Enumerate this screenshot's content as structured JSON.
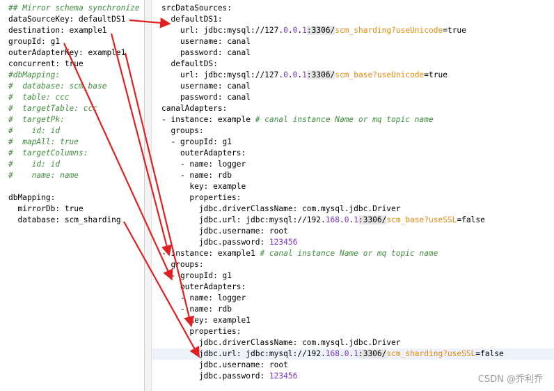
{
  "left_editor": {
    "lines": [
      {
        "parts": [
          {
            "t": "## Mirror schema synchronize",
            "c": "cmt"
          }
        ]
      },
      {
        "parts": [
          {
            "t": "dataSourceKey: defaultDS1",
            "c": ""
          }
        ]
      },
      {
        "parts": [
          {
            "t": "destination: example1",
            "c": ""
          }
        ]
      },
      {
        "parts": [
          {
            "t": "groupId: g1",
            "c": ""
          }
        ]
      },
      {
        "parts": [
          {
            "t": "outerAdapterKey: example1",
            "c": ""
          }
        ]
      },
      {
        "parts": [
          {
            "t": "concurrent: true",
            "c": ""
          }
        ]
      },
      {
        "parts": [
          {
            "t": "#dbMapping:",
            "c": "cmt"
          }
        ]
      },
      {
        "parts": [
          {
            "t": "#  database: scm_base",
            "c": "cmt"
          }
        ]
      },
      {
        "parts": [
          {
            "t": "#  table: ccc",
            "c": "cmt"
          }
        ]
      },
      {
        "parts": [
          {
            "t": "#  targetTable: ccc",
            "c": "cmt"
          }
        ]
      },
      {
        "parts": [
          {
            "t": "#  targetPk:",
            "c": "cmt"
          }
        ]
      },
      {
        "parts": [
          {
            "t": "#    id: id",
            "c": "cmt"
          }
        ]
      },
      {
        "parts": [
          {
            "t": "#  mapAll: true",
            "c": "cmt"
          }
        ]
      },
      {
        "parts": [
          {
            "t": "#  targetColumns:",
            "c": "cmt"
          }
        ]
      },
      {
        "parts": [
          {
            "t": "#    id: id",
            "c": "cmt"
          }
        ]
      },
      {
        "parts": [
          {
            "t": "#    name: name",
            "c": "cmt"
          }
        ]
      },
      {
        "parts": [
          {
            "t": "",
            "c": ""
          }
        ]
      },
      {
        "parts": [
          {
            "t": "dbMapping:",
            "c": ""
          }
        ]
      },
      {
        "parts": [
          {
            "t": "  mirrorDb: true",
            "c": ""
          }
        ]
      },
      {
        "parts": [
          {
            "t": "  database: scm_sharding",
            "c": ""
          }
        ]
      }
    ]
  },
  "right_editor": {
    "lines": [
      {
        "parts": [
          {
            "t": "srcDataSources:",
            "c": ""
          }
        ]
      },
      {
        "parts": [
          {
            "t": "  defaultDS1:",
            "c": ""
          }
        ]
      },
      {
        "parts": [
          {
            "t": "    url: jdbc:mysql://127.",
            "c": ""
          },
          {
            "t": "0",
            "c": "num"
          },
          {
            "t": ".",
            "c": ""
          },
          {
            "t": "0",
            "c": "num"
          },
          {
            "t": ".",
            "c": ""
          },
          {
            "t": "1",
            "c": "num"
          },
          {
            "t": ":3306/",
            "c": "boxed"
          },
          {
            "t": "scm_sharding?useUnicode",
            "c": "orng"
          },
          {
            "t": "=true",
            "c": ""
          }
        ]
      },
      {
        "parts": [
          {
            "t": "    username: canal",
            "c": ""
          }
        ]
      },
      {
        "parts": [
          {
            "t": "    password: canal",
            "c": ""
          }
        ]
      },
      {
        "parts": [
          {
            "t": "  defaultDS:",
            "c": ""
          }
        ]
      },
      {
        "parts": [
          {
            "t": "    url: jdbc:mysql://127.",
            "c": ""
          },
          {
            "t": "0",
            "c": "num"
          },
          {
            "t": ".",
            "c": ""
          },
          {
            "t": "0",
            "c": "num"
          },
          {
            "t": ".",
            "c": ""
          },
          {
            "t": "1",
            "c": "num"
          },
          {
            "t": ":3306/",
            "c": "boxed"
          },
          {
            "t": "scm_base?useUnicode",
            "c": "orng"
          },
          {
            "t": "=true",
            "c": ""
          }
        ]
      },
      {
        "parts": [
          {
            "t": "    username: canal",
            "c": ""
          }
        ]
      },
      {
        "parts": [
          {
            "t": "    password: canal",
            "c": ""
          }
        ]
      },
      {
        "parts": [
          {
            "t": "canalAdapters:",
            "c": ""
          }
        ]
      },
      {
        "parts": [
          {
            "t": "- instance: example ",
            "c": ""
          },
          {
            "t": "# canal instance Name or mq topic name",
            "c": "cmt"
          }
        ]
      },
      {
        "parts": [
          {
            "t": "  groups:",
            "c": ""
          }
        ]
      },
      {
        "parts": [
          {
            "t": "  - groupId: g1",
            "c": ""
          }
        ]
      },
      {
        "parts": [
          {
            "t": "    outerAdapters:",
            "c": ""
          }
        ]
      },
      {
        "parts": [
          {
            "t": "    - name: logger",
            "c": ""
          }
        ]
      },
      {
        "parts": [
          {
            "t": "    - name: rdb",
            "c": ""
          }
        ]
      },
      {
        "parts": [
          {
            "t": "      key: example",
            "c": ""
          }
        ]
      },
      {
        "parts": [
          {
            "t": "      properties:",
            "c": ""
          }
        ]
      },
      {
        "parts": [
          {
            "t": "        jdbc.driverClassName: com.mysql.jdbc.Driver",
            "c": ""
          }
        ]
      },
      {
        "parts": [
          {
            "t": "        jdbc.url: jdbc:mysql://192.",
            "c": ""
          },
          {
            "t": "168",
            "c": "num"
          },
          {
            "t": ".",
            "c": ""
          },
          {
            "t": "0",
            "c": "num"
          },
          {
            "t": ".",
            "c": ""
          },
          {
            "t": "1",
            "c": "num"
          },
          {
            "t": ":3306/",
            "c": "boxed"
          },
          {
            "t": "scm_base?useSSL",
            "c": "orng"
          },
          {
            "t": "=false",
            "c": ""
          }
        ]
      },
      {
        "parts": [
          {
            "t": "        jdbc.username: root",
            "c": ""
          }
        ]
      },
      {
        "parts": [
          {
            "t": "        jdbc.password: ",
            "c": ""
          },
          {
            "t": "123456",
            "c": "num"
          }
        ]
      },
      {
        "parts": [
          {
            "t": "- instance: example1 ",
            "c": ""
          },
          {
            "t": "# canal instance Name or mq topic name",
            "c": "cmt"
          }
        ]
      },
      {
        "parts": [
          {
            "t": "  groups:",
            "c": ""
          }
        ]
      },
      {
        "parts": [
          {
            "t": "  - groupId: g1",
            "c": ""
          }
        ]
      },
      {
        "parts": [
          {
            "t": "    outerAdapters:",
            "c": ""
          }
        ]
      },
      {
        "parts": [
          {
            "t": "    - name: logger",
            "c": ""
          }
        ]
      },
      {
        "parts": [
          {
            "t": "    - name: rdb",
            "c": ""
          }
        ]
      },
      {
        "parts": [
          {
            "t": "      key: example1",
            "c": ""
          }
        ]
      },
      {
        "parts": [
          {
            "t": "      properties:",
            "c": ""
          }
        ]
      },
      {
        "parts": [
          {
            "t": "        jdbc.driverClassName: com.mysql.jdbc.Driver",
            "c": ""
          }
        ]
      },
      {
        "parts": [
          {
            "t": "        jdbc.url: jdbc:mysql://192.",
            "c": ""
          },
          {
            "t": "168",
            "c": "num"
          },
          {
            "t": ".",
            "c": ""
          },
          {
            "t": "0",
            "c": "num"
          },
          {
            "t": ".",
            "c": ""
          },
          {
            "t": "1",
            "c": "num"
          },
          {
            "t": ":3306/",
            "c": "boxed"
          },
          {
            "t": "scm_sharding?useSSL",
            "c": "orng"
          },
          {
            "t": "=false",
            "c": ""
          }
        ],
        "highlight": true
      },
      {
        "parts": [
          {
            "t": "        jdbc.username: root",
            "c": ""
          }
        ]
      },
      {
        "parts": [
          {
            "t": "        jdbc.password: ",
            "c": ""
          },
          {
            "t": "123456",
            "c": "num"
          }
        ]
      }
    ]
  },
  "watermark": "CSDN @乔利乔",
  "colors": {
    "arrow": "#e02020",
    "comment": "#3f8f3f",
    "number": "#7a33cc",
    "link": "#e8890c"
  }
}
